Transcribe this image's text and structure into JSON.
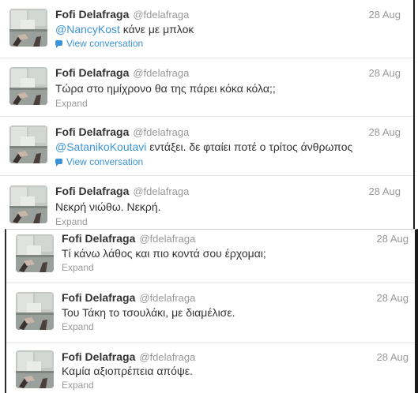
{
  "avatar_icon": "profile-photo-avatar",
  "accent_color": "#3b94d9",
  "tweets": [
    {
      "name": "Fofi Delafraga",
      "handle": "@fdelafraga",
      "time": "28 Aug",
      "mention": "@NancyKost",
      "text": " κάνε με μπλοκ",
      "action": "View conversation"
    },
    {
      "name": "Fofi Delafraga",
      "handle": "@fdelafraga",
      "time": "28 Aug",
      "mention": "",
      "text": "Τώρα στο ημίχρονο θα της πάρει κόκα κόλα;;",
      "action": "Expand"
    },
    {
      "name": "Fofi Delafraga",
      "handle": "@fdelafraga",
      "time": "28 Aug",
      "mention": "@SatanikoKoutavi",
      "text": " εντάξει. δε φταίει ποτέ ο τρίτος άνθρωπος",
      "action": "View conversation"
    },
    {
      "name": "Fofi Delafraga",
      "handle": "@fdelafraga",
      "time": "28 Aug",
      "mention": "",
      "text": "Νεκρή νιώθω. Νεκρή.",
      "action": "Expand"
    },
    {
      "name": "Fofi Delafraga",
      "handle": "@fdelafraga",
      "time": "28 Aug",
      "mention": "",
      "text": "Τί κάνω λάθος και πιο κοντά σου έρχομαι;",
      "action": "Expand"
    },
    {
      "name": "Fofi Delafraga",
      "handle": "@fdelafraga",
      "time": "28 Aug",
      "mention": "",
      "text": "Του Τάκη το τσουλάκι, με διαμέλισε.",
      "action": "Expand"
    },
    {
      "name": "Fofi Delafraga",
      "handle": "@fdelafraga",
      "time": "28 Aug",
      "mention": "",
      "text": "Καμία αξιοπρέπεια απόψε.",
      "action": "Expand"
    }
  ]
}
